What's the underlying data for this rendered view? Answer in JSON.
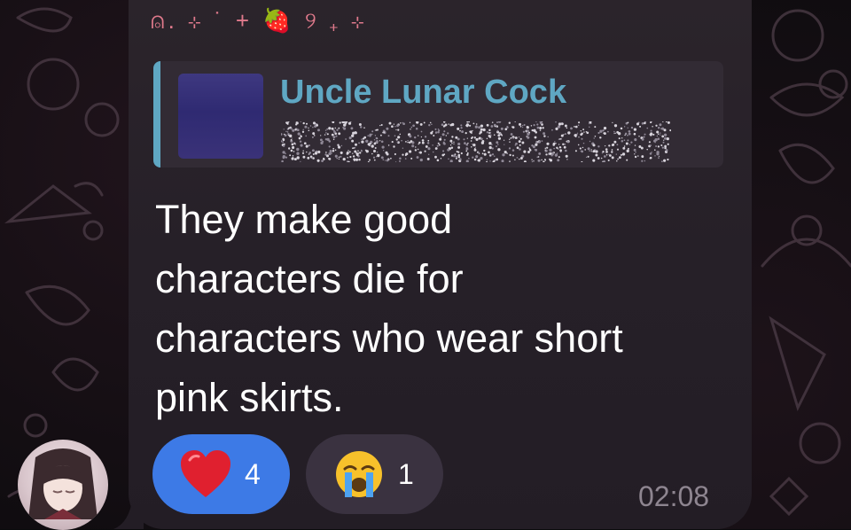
{
  "header_decoration": "⍝. ⊹ ˙ + 🍓 ୨ ₊ ⊹",
  "reply": {
    "sender_name": "Uncle Lunar Cock",
    "preview_hidden": true,
    "accent_color": "#5fa7c3"
  },
  "message": {
    "lines": [
      "They make good",
      "characters die for",
      "characters who wear short",
      "pink skirts."
    ],
    "time": "02:08"
  },
  "reactions": [
    {
      "emoji": "heart-icon",
      "count": "4",
      "selected": true,
      "color": "#3d7ae6"
    },
    {
      "emoji": "crying-face-icon",
      "count": "1",
      "selected": false,
      "color": "#3a3240"
    }
  ]
}
